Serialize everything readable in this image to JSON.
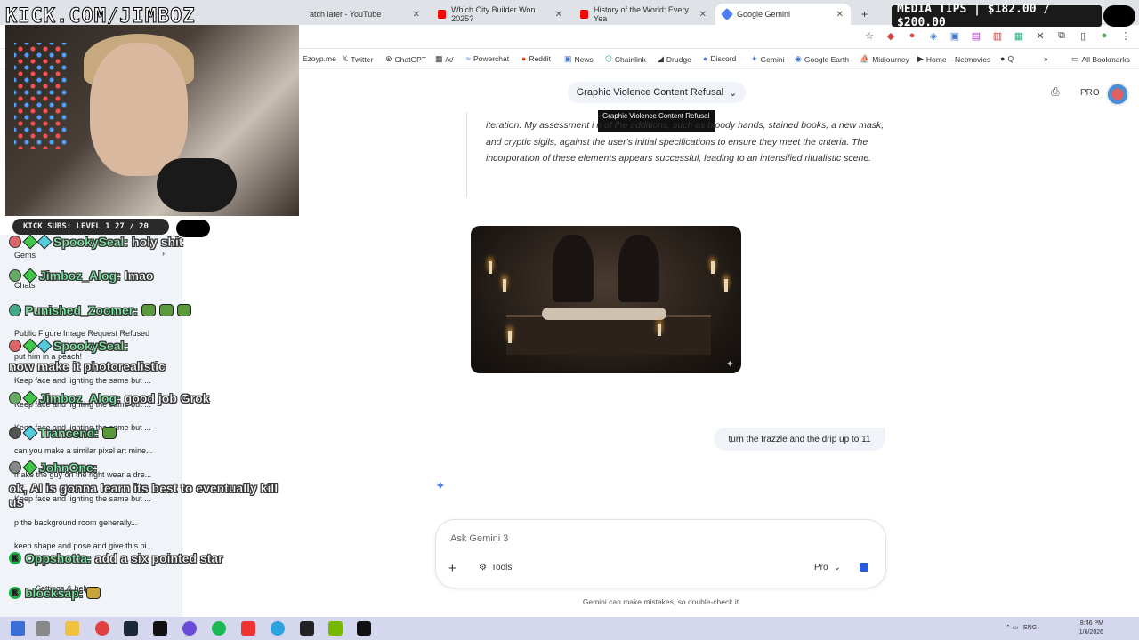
{
  "browser": {
    "tabs": [
      {
        "label": "atch later - YouTube",
        "color": "#ff0000"
      },
      {
        "label": "Which City Builder Won 2025?",
        "color": "#ff0000"
      },
      {
        "label": "History of the World: Every Yea",
        "color": "#ff0000"
      },
      {
        "label": "Google Gemini",
        "color": "#4a7ef0"
      }
    ],
    "new_tab": "+",
    "bookmarks": [
      "Ezoyp.me",
      "Twitter",
      "ChatGPT",
      "/x/",
      "Powerchat",
      "Reddit",
      "News",
      "Chainlink",
      "Drudge",
      "Discord",
      "Gemini",
      "Google Earth",
      "Midjourney",
      "Home – Netmovies",
      "Q"
    ],
    "all_bookmarks": "All Bookmarks",
    "more_chevron": "»"
  },
  "overlay": {
    "kick_url": "KICK.COM/JIMBOZ",
    "media_tips": "MEDIA TIPS | $182.00 / $200.00",
    "kick_subs": "KICK SUBS: LEVEL 1 27 / 20"
  },
  "sidebar": {
    "items": [
      "Gems",
      "Chats",
      "Public Figure Image Request Refused",
      "put him in a peach!",
      "Keep face and lighting the same but ...",
      "Keep face and lighting the same but ...",
      "Keep face and lighting the same but ...",
      "can you make a similar pixel art mine...",
      "make the guy on the right wear a dre...",
      "Keep face and lighting the same but ...",
      "p the background room generally...",
      "keep shape and pose and give this pi...",
      "Settings & help"
    ]
  },
  "stream_chat": [
    {
      "user": "SpookySeal:",
      "msg": "holy shit",
      "badge": "k"
    },
    {
      "user": "Jimboz_Alog:",
      "msg": "lmao"
    },
    {
      "user": "Punished_Zoomer:",
      "msg": ""
    },
    {
      "user": "SpookySeal:",
      "msg": "now make it photorealistic"
    },
    {
      "user": "Jimboz_Alog:",
      "msg": "good job Grok"
    },
    {
      "user": "Trancend:",
      "msg": ""
    },
    {
      "user": "JohnOne:",
      "msg": "ok, AI is gonna learn its best to eventually kill us"
    },
    {
      "user": "Oppshotta:",
      "msg": "add a six pointed star"
    },
    {
      "user": "blocksap:",
      "msg": ""
    }
  ],
  "gemini": {
    "conversation_title": "Graphic Violence Content Refusal",
    "tooltip": "Graphic Violence Content Refusal",
    "pro_label": "PRO",
    "thoughts_text": "iteration. My assessment i                              n of the additions, such as bloody hands, stained books, a new mask, and cryptic sigils, against the user's initial specifications to ensure they meet the criteria. The incorporation of these elements appears successful, leading to an intensified ritualistic scene.",
    "user_message": "turn the frazzle and the drip up to 11",
    "input_placeholder": "Ask Gemini 3",
    "tools_label": "Tools",
    "mode_label": "Pro",
    "disclaimer": "Gemini can make mistakes, so double-check it"
  },
  "taskbar": {
    "lang": "ENG",
    "time": "8:46 PM",
    "date": "1/6/2026"
  }
}
